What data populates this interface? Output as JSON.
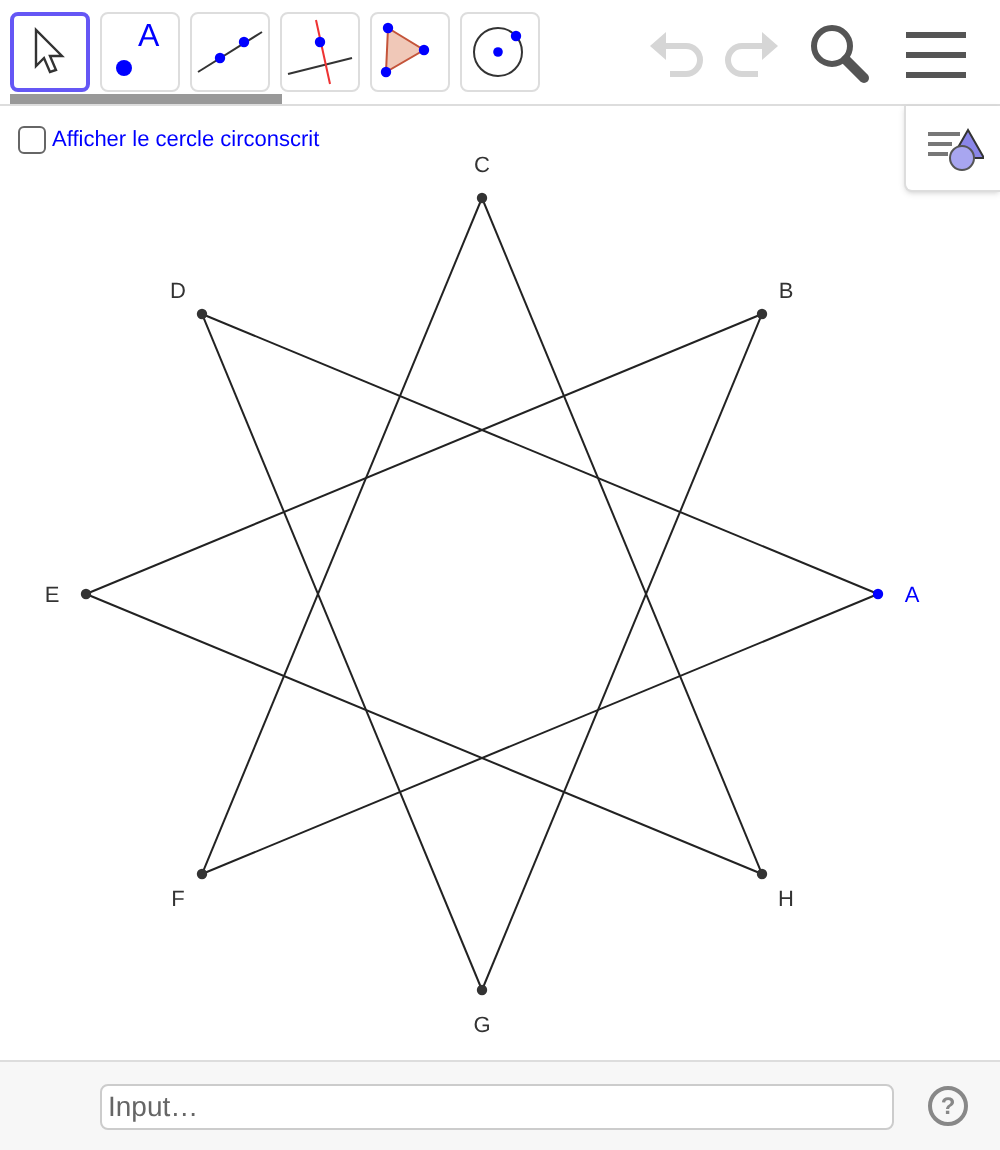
{
  "toolbar": {
    "tools": [
      {
        "kind": "move",
        "selected": true
      },
      {
        "kind": "point",
        "label": "A",
        "selected": false
      },
      {
        "kind": "line",
        "selected": false
      },
      {
        "kind": "perpendicular",
        "selected": false
      },
      {
        "kind": "polygon",
        "selected": false
      },
      {
        "kind": "circle",
        "selected": false
      }
    ],
    "undo": {
      "disabled": true
    },
    "redo": {
      "disabled": true
    }
  },
  "canvas": {
    "checkbox": {
      "label": "Afficher le cercle circonscrit",
      "checked": false
    },
    "points": [
      {
        "label": "A",
        "color": "#0000ff"
      },
      {
        "label": "B",
        "color": "#333333"
      },
      {
        "label": "C",
        "color": "#333333"
      },
      {
        "label": "D",
        "color": "#333333"
      },
      {
        "label": "E",
        "color": "#333333"
      },
      {
        "label": "F",
        "color": "#333333"
      },
      {
        "label": "G",
        "color": "#333333"
      },
      {
        "label": "H",
        "color": "#333333"
      }
    ]
  },
  "input_bar": {
    "placeholder": "Input…",
    "help": "?"
  }
}
